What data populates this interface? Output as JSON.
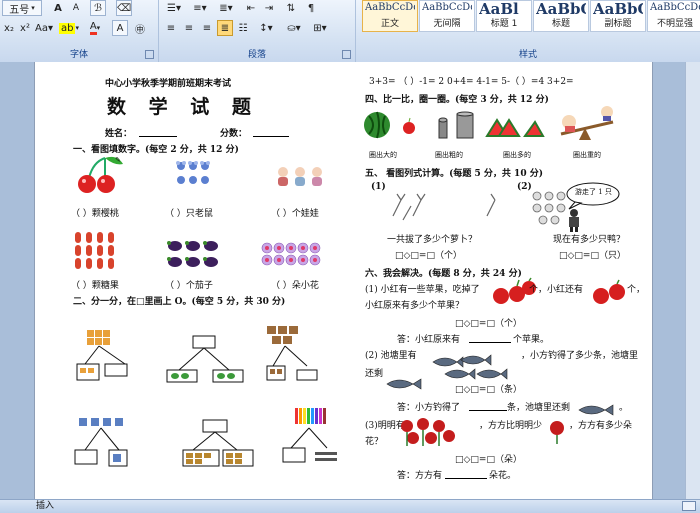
{
  "ribbon": {
    "font_size_value": "五号",
    "groups": {
      "font": "字体",
      "paragraph": "段落",
      "styles": "样式"
    },
    "styles": [
      {
        "sample": "AaBbCcDd",
        "name": "正文",
        "active": true
      },
      {
        "sample": "AaBbCcDd",
        "name": "无间隔",
        "active": false
      },
      {
        "sample": "AaBl",
        "name": "标题 1",
        "active": false
      },
      {
        "sample": "AaBbC",
        "name": "标题",
        "active": false
      },
      {
        "sample": "AaBbC",
        "name": "副标题",
        "active": false
      },
      {
        "sample": "AaBbCcDd",
        "name": "不明显强",
        "active": false
      }
    ]
  },
  "status": {
    "mode": "插入"
  },
  "doc": {
    "school": "中心小学秋季学期前班期末考试",
    "title": "数 学 试 题",
    "name_label": "姓名：",
    "score_label": "分数：",
    "sec1": {
      "heading": "一、看图填数字。(每空 2 分，共 12 分)",
      "labels": [
        "（  ）颗樱桃",
        "（  ）只老鼠",
        "（  ）个娃娃",
        "（  ）颗糖果",
        "（  ）个茄子",
        "（  ）朵小花"
      ]
    },
    "sec2": {
      "heading": "二、分一分，在□里画上 O。(每空 5 分，共 30 分)"
    },
    "top_equations": "3+3=     （    ）-1= 2      0+4=     4-1=     5-（   ）=4     3+2=",
    "sec4": {
      "heading": "四、比一比，圈一圈。(每空 3 分，共 12 分)",
      "captions": [
        "圈出大的",
        "圈出粗的",
        "圈出多的",
        "圈出重的"
      ]
    },
    "sec5": {
      "heading": "五、 看图列式计算。(每题 5 分，共 10 分)",
      "num1": "(1)",
      "num2": "(2)",
      "bubble": "游走了 1 只",
      "q1": "一共拔了多少个萝卜？",
      "q2": "现在有多少只鸭？",
      "f1": "□◇□=□（个）",
      "f2": "□◇□=□（只）"
    },
    "sec6": {
      "heading": "六、我会解决。(每题 8 分，共 24 分)",
      "p1a": "(1) 小红有一些苹果，吃掉了",
      "p1b": "个，小红还有",
      "p1c": "个，",
      "p1d": "小红原来有多少个苹果？",
      "f1": "□◇□=□（个）",
      "a1a": "答：小红原来有",
      "a1b": "个苹果。",
      "p2a": "(2) 池塘里有",
      "p2b": "，小方钓得了多少条，池塘里",
      "p2c": "还剩",
      "f2": "□◇□=□（条）",
      "a2a": "答：小方钓得了",
      "a2b": "条，池塘里还剩",
      "a2c": "。",
      "p3a": "(3)明明有",
      "p3b": "，方方比明明少",
      "p3c": "，方方有多少朵",
      "p3d": "花？",
      "f3": "□◇□=□（朵）",
      "a3a": "答：方方有",
      "a3b": "朵花。"
    }
  }
}
